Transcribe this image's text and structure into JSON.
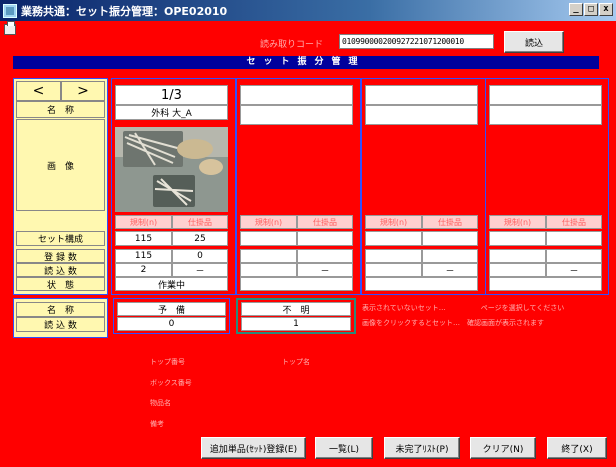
{
  "window": {
    "title": "業務共通：セット振分管理：OPE02010",
    "minimize": "_",
    "maximize": "□",
    "close": "x"
  },
  "toolbar": {
    "barcode_label": "読み取りコード",
    "barcode_value": "010990000200927221071200010",
    "read_button": "読込"
  },
  "header": {
    "title": "セット振分管理"
  },
  "left_panel": {
    "prev": "<",
    "next": ">",
    "name_label": "名　称",
    "image_label": "画　像",
    "set_config_label": "セット構成",
    "registered_label": "登 録 数",
    "read_count_label": "読 込 数",
    "status_label": "状　態"
  },
  "columns": [
    {
      "page": "1/3",
      "name": "外科 大_A",
      "sub_header_left": "規制(n)",
      "sub_header_right": "仕掛品",
      "set_config": [
        "115",
        "25"
      ],
      "registered": [
        "115",
        "0"
      ],
      "read": [
        "2",
        "－"
      ],
      "status": "作業中"
    },
    {
      "page": "",
      "name": "",
      "sub_header_left": "規制(n)",
      "sub_header_right": "仕掛品",
      "set_config": [
        "",
        ""
      ],
      "registered": [
        "",
        ""
      ],
      "read": [
        "",
        "－"
      ],
      "status": ""
    },
    {
      "page": "",
      "name": "",
      "sub_header_left": "規制(n)",
      "sub_header_right": "仕掛品",
      "set_config": [
        "",
        ""
      ],
      "registered": [
        "",
        ""
      ],
      "read": [
        "",
        "－"
      ],
      "status": ""
    },
    {
      "page": "",
      "name": "",
      "sub_header_left": "規制(n)",
      "sub_header_right": "仕掛品",
      "set_config": [
        "",
        ""
      ],
      "registered": [
        "",
        ""
      ],
      "read": [
        "",
        "－"
      ],
      "status": ""
    }
  ],
  "bottom": {
    "name_label": "名　称",
    "read_label": "読 込 数",
    "spare_name": "予　備",
    "spare_count": "0",
    "unknown_name": "不　明",
    "unknown_count": "1",
    "message_line1": "表示されていないセット…　　　　　ページを選択してください",
    "message_line2": "画像をクリックするとセット…　確認画面が表示されます"
  },
  "info_labels": {
    "line1_left": "トップ番号",
    "line1_right": "トップ名",
    "line2": "ボックス番号",
    "line3": "物品名",
    "line4": "備考"
  },
  "footer_buttons": {
    "add_single": "追加単品(ｾｯﾄ)登録(E)",
    "list": "一覧(L)",
    "incomplete_list": "未完了ﾘｽﾄ(P)",
    "clear": "クリア(N)",
    "end": "終了(X)"
  },
  "colors": {
    "background": "#ff0000",
    "header_bar": "#00009c",
    "label_cell": "#fff8b0",
    "accent_border": "#2a8a7a"
  }
}
